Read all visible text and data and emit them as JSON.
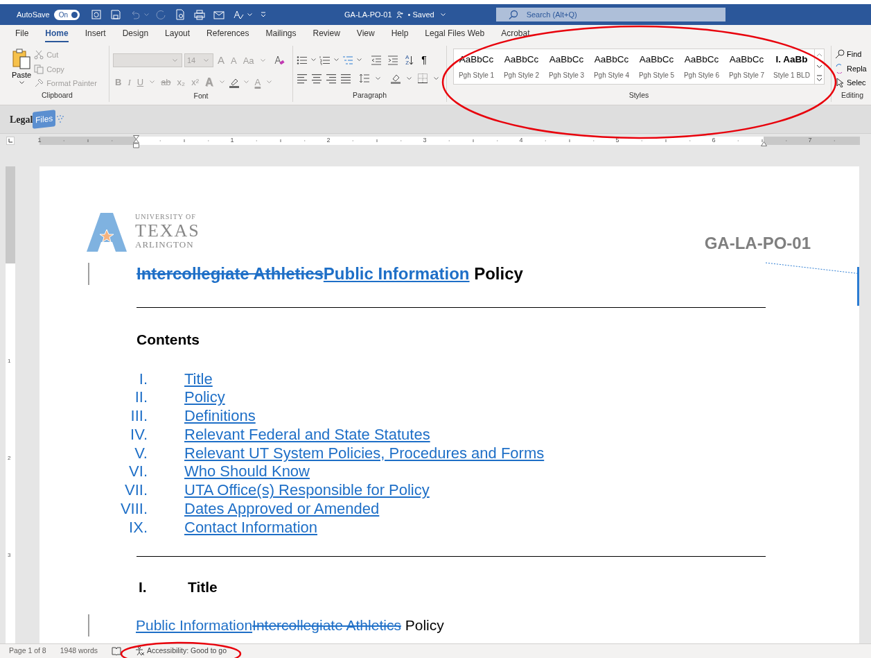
{
  "title_bar": {
    "autosave_label": "AutoSave",
    "autosave": {
      "label": "On",
      "on": true
    },
    "document_name": "GA-LA-PO-01",
    "save_status": "• Saved",
    "search": {
      "placeholder": "Search (Alt+Q)"
    }
  },
  "ribbon_tabs": [
    {
      "label": "File",
      "selected": false
    },
    {
      "label": "Home",
      "selected": true
    },
    {
      "label": "Insert",
      "selected": false
    },
    {
      "label": "Design",
      "selected": false
    },
    {
      "label": "Layout",
      "selected": false
    },
    {
      "label": "References",
      "selected": false
    },
    {
      "label": "Mailings",
      "selected": false
    },
    {
      "label": "Review",
      "selected": false
    },
    {
      "label": "View",
      "selected": false
    },
    {
      "label": "Help",
      "selected": false
    },
    {
      "label": "Legal Files Web",
      "selected": false
    },
    {
      "label": "Acrobat",
      "selected": false
    }
  ],
  "clipboard": {
    "paste": "Paste",
    "actions": [
      {
        "label": "Cut",
        "kind": "cut",
        "disabled": true
      },
      {
        "label": "Copy",
        "kind": "copy",
        "disabled": true
      },
      {
        "label": "Format Painter",
        "kind": "painter",
        "disabled": true
      }
    ],
    "group_label": "Clipboard"
  },
  "font": {
    "disabled": true,
    "font_size": "14",
    "size_buttons": [
      {
        "glyph": "A",
        "kind": "grow"
      },
      {
        "glyph": "A",
        "kind": "shrink"
      }
    ],
    "case_button": "Aa",
    "format_buttons": [
      {
        "glyph": "B",
        "kind": "bold"
      },
      {
        "glyph": "I",
        "kind": "italic"
      },
      {
        "glyph": "U",
        "kind": "underline"
      },
      {
        "glyph": "ab",
        "kind": "strike"
      },
      {
        "glyph": "x₂",
        "kind": "sub"
      },
      {
        "glyph": "x²",
        "kind": "sup"
      },
      {
        "glyph": "A",
        "kind": "effects"
      },
      {
        "glyph": "A",
        "kind": "color"
      }
    ],
    "group_label": "Font"
  },
  "paragraph": {
    "pilcrow": "¶",
    "sort_glyphs": [
      "A",
      "Z"
    ],
    "group_label": "Paragraph"
  },
  "styles": {
    "circled": true,
    "group_label": "Styles",
    "items": [
      {
        "preview": "AaBbCc",
        "name": "Pgh Style 1",
        "kind": "normal"
      },
      {
        "preview": "AaBbCc",
        "name": "Pgh Style 2",
        "kind": "normal"
      },
      {
        "preview": "AaBbCc",
        "name": "Pgh Style 3",
        "kind": "normal"
      },
      {
        "preview": "AaBbCc",
        "name": "Pgh Style 4",
        "kind": "normal"
      },
      {
        "preview": "AaBbCc",
        "name": "Pgh Style 5",
        "kind": "normal"
      },
      {
        "preview": "AaBbCc",
        "name": "Pgh Style 6",
        "kind": "normal"
      },
      {
        "preview": "AaBbCc",
        "name": "Pgh Style 7",
        "kind": "normal"
      },
      {
        "preview": "I.  AaBb",
        "name": "Style 1 BLD",
        "kind": "bold"
      }
    ]
  },
  "editing": {
    "group_label": "Editing",
    "actions": [
      {
        "label": "Find",
        "kind": "find"
      },
      {
        "label": "Repla",
        "kind": "replace"
      },
      {
        "label": "Selec",
        "kind": "select"
      }
    ]
  },
  "addin_bar": {
    "logo_words": [
      "Legal",
      "Files"
    ]
  },
  "ruler": {
    "numbers": [
      "1",
      "1",
      "2",
      "3",
      "4",
      "5",
      "6",
      "7"
    ]
  },
  "vertical_ruler": {
    "numbers": [
      "1",
      "2",
      "3"
    ]
  },
  "document": {
    "has_comment": true,
    "doc_code": "GA-LA-PO-01",
    "logo_lines": [
      "UNIVERSITY OF",
      "TEXAS",
      "ARLINGTON"
    ],
    "title": {
      "changed": true,
      "segments": [
        {
          "text": "Intercollegiate Athletics",
          "kind": "deleted"
        },
        {
          "text": "Public Information",
          "kind": "inserted"
        },
        {
          "text": " Policy",
          "kind": "plain"
        }
      ]
    },
    "contents_heading": "Contents",
    "toc": [
      {
        "numeral": "I.",
        "text": "Title"
      },
      {
        "numeral": "II.",
        "text": "Policy"
      },
      {
        "numeral": "III.",
        "text": "Definitions"
      },
      {
        "numeral": "IV.",
        "text": "Relevant Federal and State Statutes"
      },
      {
        "numeral": "V.",
        "text": "Relevant UT System Policies, Procedures and Forms"
      },
      {
        "numeral": "VI.",
        "text": "Who Should Know"
      },
      {
        "numeral": "VII.",
        "text": "UTA Office(s) Responsible for Policy"
      },
      {
        "numeral": "VIII.",
        "text": "Dates Approved or Amended"
      },
      {
        "numeral": "IX.",
        "text": "Contact Information"
      }
    ],
    "sections": [
      {
        "numeral": "I.",
        "heading": "Title",
        "body": {
          "changed": true,
          "segments": [
            {
              "text": "Public Information",
              "kind": "inserted"
            },
            {
              "text": "Intercollegiate Athletics",
              "kind": "deleted"
            },
            {
              "text": " Policy",
              "kind": "plain"
            }
          ]
        }
      }
    ]
  },
  "status_bar": {
    "page": "Page 1 of 8",
    "words": "1948 words",
    "accessibility": "Accessibility: Good to go",
    "circled": true
  }
}
